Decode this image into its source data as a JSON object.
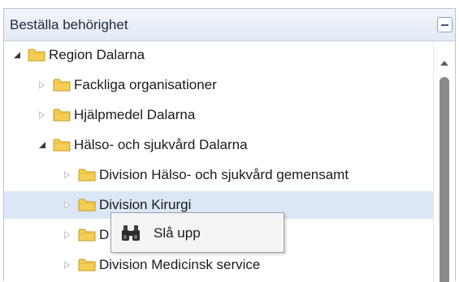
{
  "panel": {
    "title": "Beställa behörighet",
    "collapse_icon": "minus-icon"
  },
  "tree": [
    {
      "label": "Region Dalarna",
      "level": 0,
      "expanded": true,
      "expander": "expanded-arrow-icon",
      "icon": "folder-icon",
      "selected": false
    },
    {
      "label": "Fackliga organisationer",
      "level": 1,
      "expanded": false,
      "expander": "collapsed-arrow-icon",
      "icon": "folder-icon",
      "selected": false
    },
    {
      "label": "Hjälpmedel Dalarna",
      "level": 1,
      "expanded": false,
      "expander": "collapsed-arrow-icon",
      "icon": "folder-icon",
      "selected": false
    },
    {
      "label": "Hälso- och sjukvård Dalarna",
      "level": 1,
      "expanded": true,
      "expander": "expanded-arrow-icon",
      "icon": "folder-icon",
      "selected": false
    },
    {
      "label": "Division Hälso- och sjukvård gemensamt",
      "level": 2,
      "expanded": false,
      "expander": "collapsed-arrow-icon",
      "icon": "folder-icon",
      "selected": false
    },
    {
      "label": "Division Kirurgi",
      "level": 2,
      "expanded": false,
      "expander": "collapsed-arrow-icon",
      "icon": "folder-icon",
      "selected": true
    },
    {
      "label": "D",
      "level": 2,
      "expanded": false,
      "expander": "collapsed-arrow-icon",
      "icon": "folder-icon",
      "selected": false
    },
    {
      "label": "Division Medicinsk service",
      "level": 2,
      "expanded": false,
      "expander": "collapsed-arrow-icon",
      "icon": "folder-icon",
      "selected": false
    }
  ],
  "context_menu": {
    "items": [
      {
        "label": "Slå upp",
        "icon": "binoculars-icon"
      }
    ]
  },
  "colors": {
    "header_bg": "#e2eaf4",
    "selected_row": "#dbe7f6",
    "folder_fill": "#f5cf55",
    "folder_stroke": "#c39a1f"
  }
}
